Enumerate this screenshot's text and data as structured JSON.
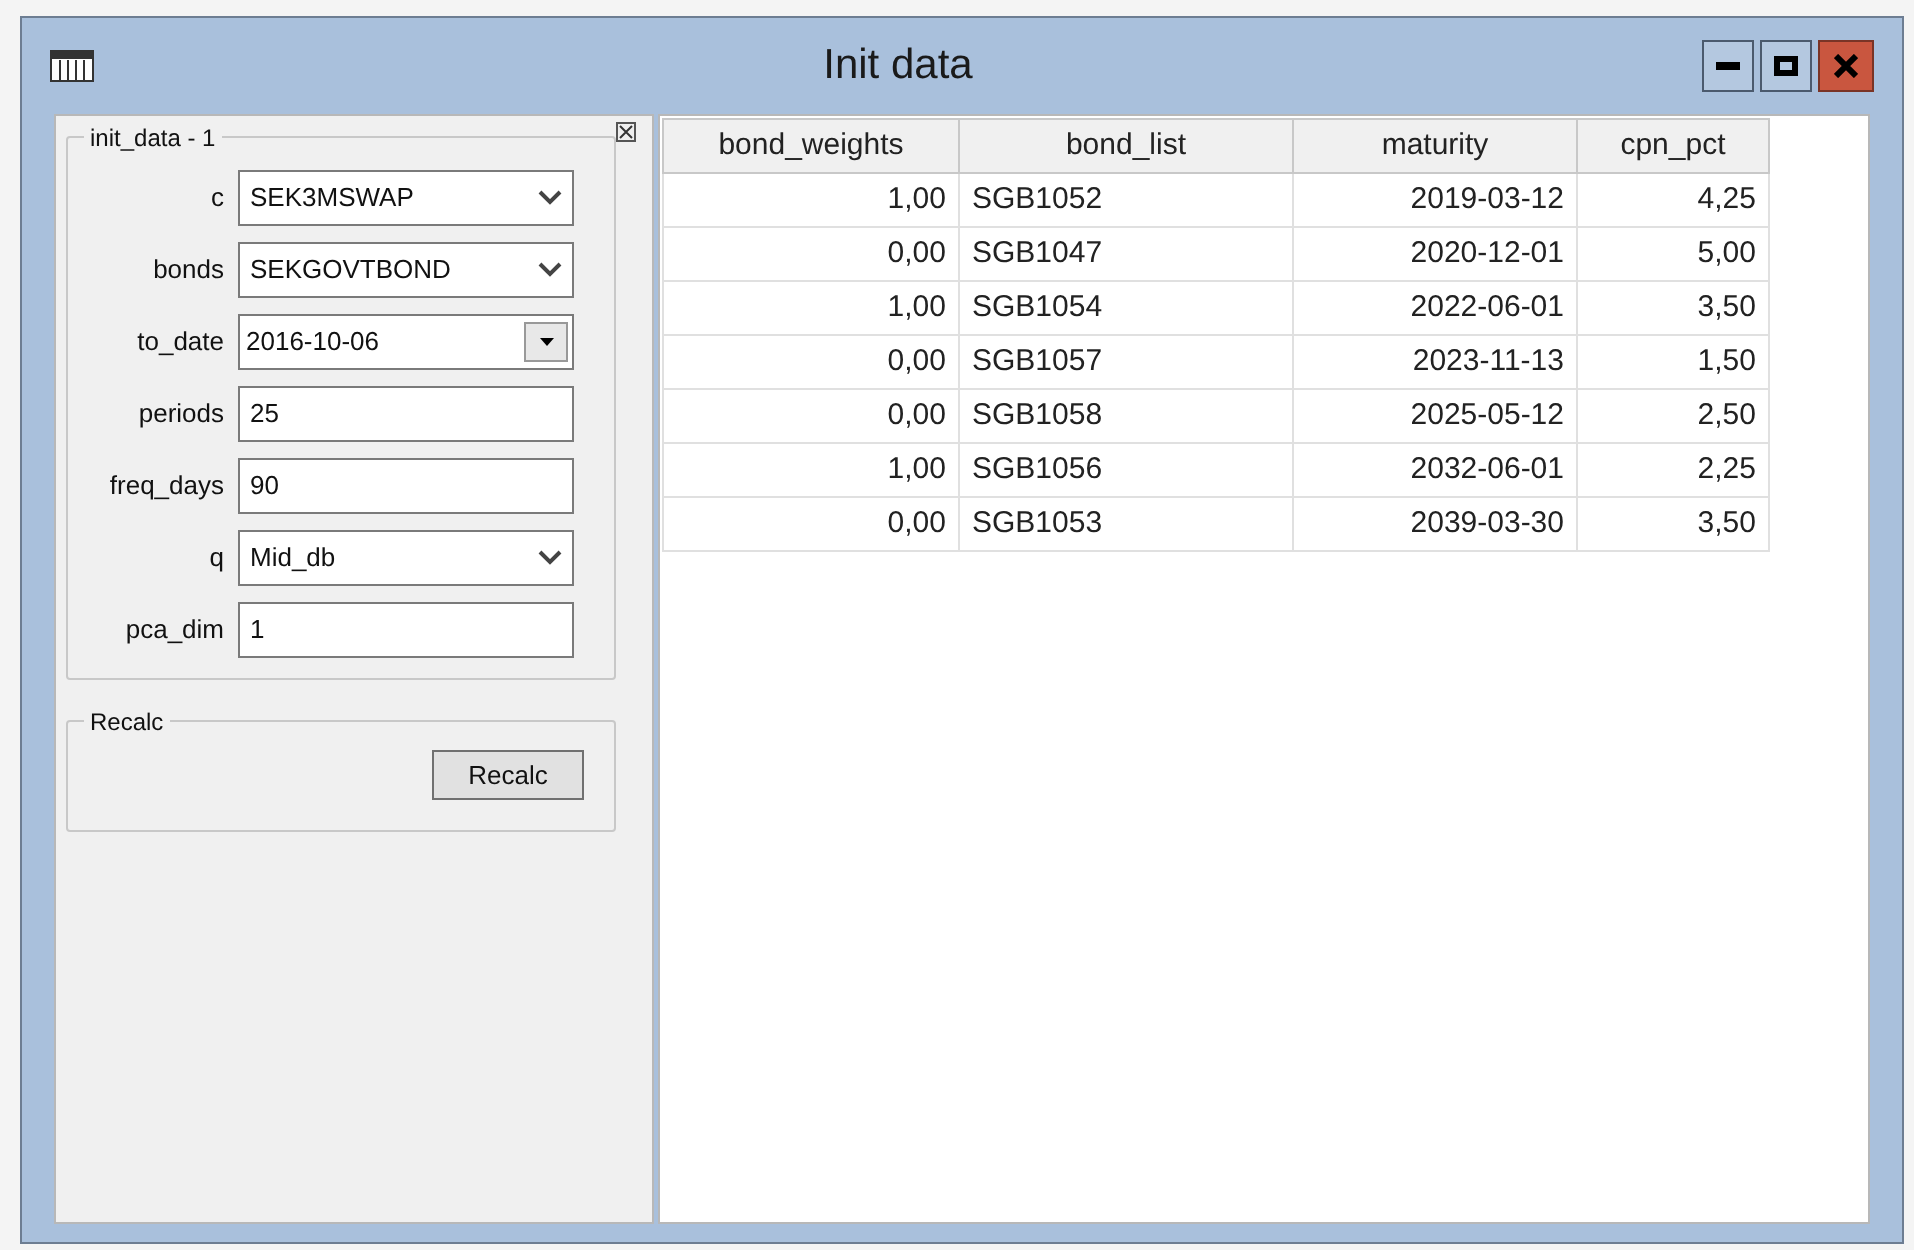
{
  "window": {
    "title": "Init data"
  },
  "form": {
    "group_title": "init_data - 1",
    "fields": [
      {
        "label": "c",
        "kind": "combo",
        "value": "SEK3MSWAP"
      },
      {
        "label": "bonds",
        "kind": "combo",
        "value": "SEKGOVTBOND"
      },
      {
        "label": "to_date",
        "kind": "date",
        "value": "2016-10-06"
      },
      {
        "label": "periods",
        "kind": "text",
        "value": "25"
      },
      {
        "label": "freq_days",
        "kind": "text",
        "value": "90"
      },
      {
        "label": "q",
        "kind": "combo",
        "value": "Mid_db"
      },
      {
        "label": "pca_dim",
        "kind": "text",
        "value": "1"
      }
    ]
  },
  "recalc": {
    "group_title": "Recalc",
    "button": "Recalc"
  },
  "table": {
    "columns": [
      "bond_weights",
      "bond_list",
      "maturity",
      "cpn_pct"
    ],
    "rows": [
      [
        "1,00",
        "SGB1052",
        "2019-03-12",
        "4,25"
      ],
      [
        "0,00",
        "SGB1047",
        "2020-12-01",
        "5,00"
      ],
      [
        "1,00",
        "SGB1054",
        "2022-06-01",
        "3,50"
      ],
      [
        "0,00",
        "SGB1057",
        "2023-11-13",
        "1,50"
      ],
      [
        "0,00",
        "SGB1058",
        "2025-05-12",
        "2,50"
      ],
      [
        "1,00",
        "SGB1056",
        "2032-06-01",
        "2,25"
      ],
      [
        "0,00",
        "SGB1053",
        "2039-03-30",
        "3,50"
      ]
    ]
  }
}
